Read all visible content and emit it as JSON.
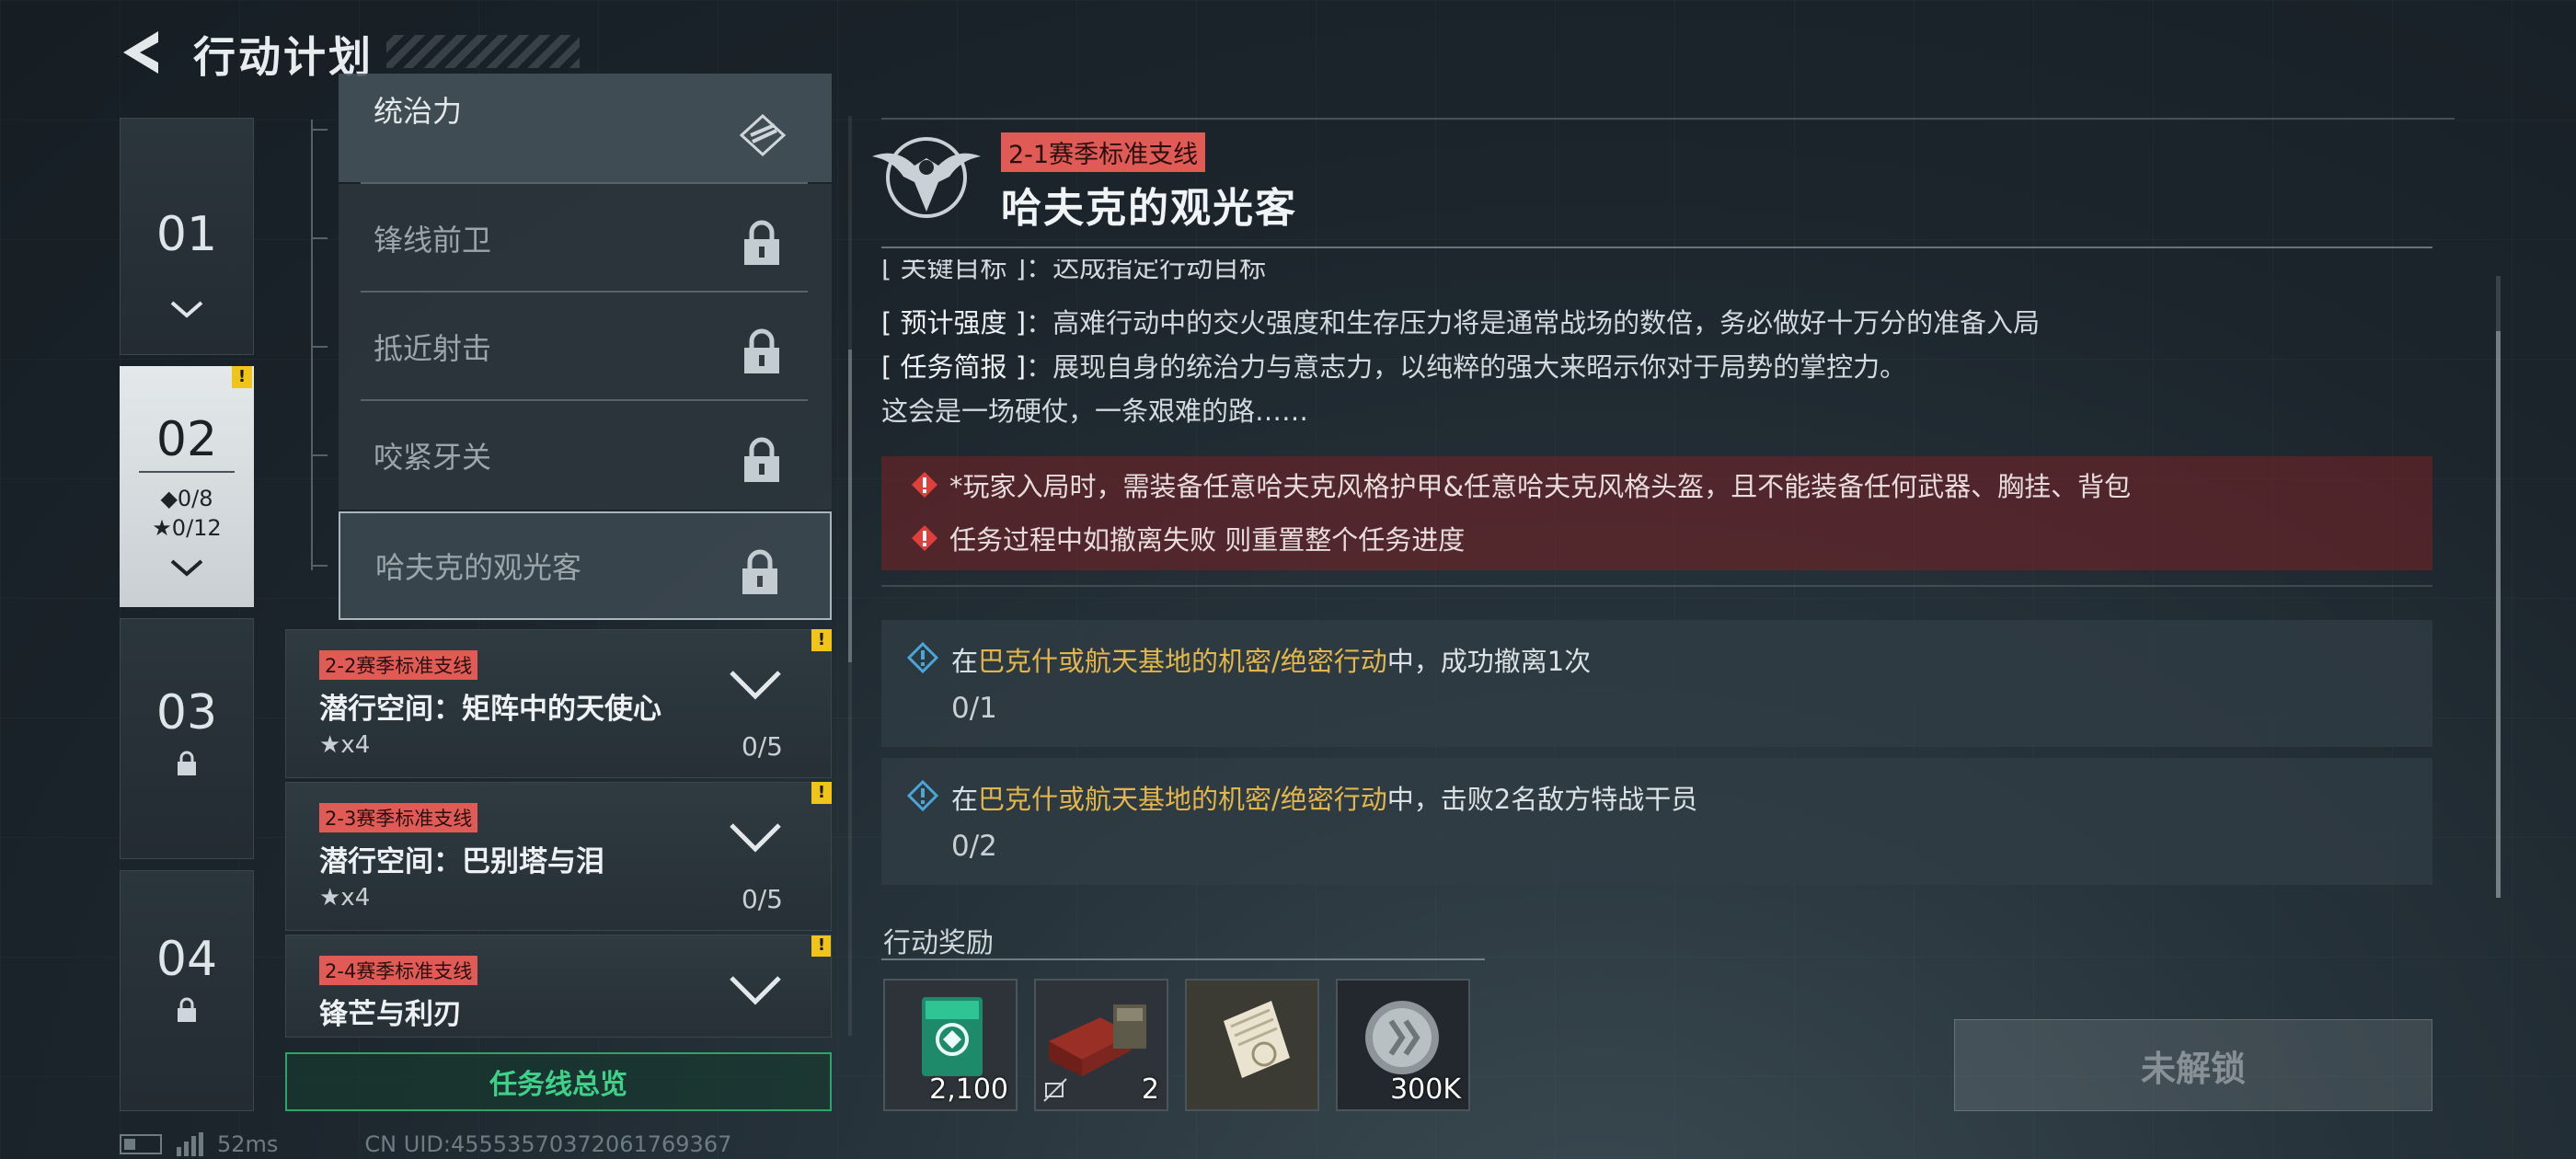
{
  "header": {
    "title": "行动计划"
  },
  "chapters": [
    {
      "num": "01"
    },
    {
      "num": "02",
      "diamond": "◆0/8",
      "star": "★0/12"
    },
    {
      "num": "03"
    },
    {
      "num": "04"
    }
  ],
  "subtasks": [
    {
      "label": "统治力"
    },
    {
      "label": "锋线前卫"
    },
    {
      "label": "抵近射击"
    },
    {
      "label": "咬紧牙关"
    },
    {
      "label": "哈夫克的观光客"
    }
  ],
  "missions": [
    {
      "tag": "2-2赛季标准支线",
      "title": "潜行空间：矩阵中的天使心",
      "reward": "★x4",
      "progress": "0/5"
    },
    {
      "tag": "2-3赛季标准支线",
      "title": "潜行空间：巴别塔与泪",
      "reward": "★x4",
      "progress": "0/5"
    },
    {
      "tag": "2-4赛季标准支线",
      "title": "锋芒与利刃",
      "reward": "",
      "progress": ""
    }
  ],
  "overview_label": "任务线总览",
  "status": {
    "ping": "52ms",
    "uid": "CN UID:45553570372061769367"
  },
  "detail": {
    "tag": "2-1赛季标准支线",
    "title": "哈夫克的观光客",
    "cut_line": "[ 关键目标 ]：达成指定行动目标",
    "intensity_key": "[ 预计强度 ]",
    "intensity": "：高难行动中的交火强度和生存压力将是通常战场的数倍，务必做好十万分的准备入局",
    "brief_key": "[ 任务简报 ]",
    "brief": "：展现自身的统治力与意志力，以纯粹的强大来昭示你对于局势的掌控力。",
    "flavor": "这会是一场硬仗，一条艰难的路……",
    "warnings": [
      "*玩家入局时，需装备任意哈夫克风格护甲&任意哈夫克风格头盔，且不能装备任何武器、胸挂、背包",
      "任务过程中如撤离失败 则重置整个任务进度"
    ],
    "objectives": [
      {
        "pre": "在",
        "hl": "巴克什或航天基地的机密/绝密行动",
        "post": "中，成功撤离1次",
        "progress": "0/1"
      },
      {
        "pre": "在",
        "hl": "巴克什或航天基地的机密/绝密行动",
        "post": "中，击败2名敌方特战干员",
        "progress": "0/2"
      }
    ],
    "rewards_title": "行动奖励",
    "rewards": [
      {
        "name": "exp-card",
        "qty": "2,100"
      },
      {
        "name": "weapon-crate",
        "qty": "2"
      },
      {
        "name": "document-item",
        "qty": ""
      },
      {
        "name": "coin",
        "qty": "300K"
      }
    ],
    "unlock_label": "未解锁"
  }
}
